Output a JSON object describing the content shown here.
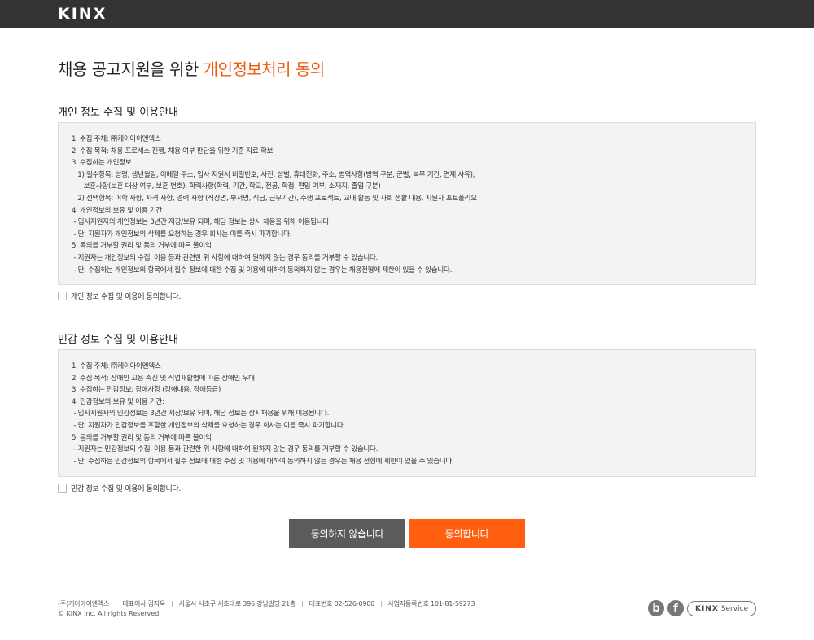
{
  "header": {
    "logo": "KINX"
  },
  "title": {
    "main": "채용 공고지원을 위한 ",
    "accent": "개인정보처리 동의"
  },
  "personal": {
    "heading": "개인 정보 수집 및 이용안내",
    "lines": [
      "1. 수집 주체: ㈜케이아이엔엑스",
      "2. 수집 목적: 채용 프로세스 진행, 채용 여부 판단을 위한 기준 자료 확보",
      "3. 수집하는 개인정보",
      "   1) 필수항목: 성명, 생년월일, 이메일 주소, 입사 지원서 비밀번호, 사진, 성별, 휴대전화, 주소, 병역사항(병역 구분, 군별, 복무 기간, 면제 사유),",
      "      보훈사항(보훈 대상 여부, 보훈 번호), 학력사항(학력, 기간, 학교, 전공, 학점, 편입 여부, 소재지, 졸업 구분)",
      "   2) 선택항목: 어학 사항, 자격 사항, 경력 사항 (직장명, 부서명, 직급, 근무기간), 수행 프로젝트, 교내 활동 및 사회 생활 내용, 지원자 포트폴리오",
      "4. 개인정보의 보유 및 이용 기간",
      " - 입사지원자의 개인정보는 3년간 저장/보유 되며, 해당 정보는 상시 채용을 위해 이용됩니다.",
      " - 단, 지원자가 개인정보의 삭제를 요청하는 경우 회사는 이를 즉시 파기합니다.",
      "5. 동의를 거부할 권리 및 동의 거부에 따른 불이익",
      " - 지원자는 개인정보의 수집, 이용 등과 관련한 위 사항에 대하여 원하지 않는 경우 동의를 거부할 수 있습니다.",
      " - 단, 수집하는 개인정보의 항목에서 필수 정보에 대한 수집 및 이용에 대하여 동의하지 않는 경우는 채용전형에 제한이 있을 수 있습니다."
    ],
    "agree_label": "개인 정보 수집 및 이용에 동의합니다."
  },
  "sensitive": {
    "heading": "민감 정보 수집 및 이용안내",
    "lines": [
      "1. 수집 주체: ㈜케이아이엔엑스",
      "2. 수집 목적: 장애인 고용 촉진 및 직업재활법에 따른 장애인 우대",
      "3. 수집하는 민감정보: 장애사항 (장애내용, 장애등급)",
      "4. 민감정보의 보유 및 이용 기간:",
      " - 입사지원자의 민감정보는 3년간 저장/보유 되며, 해당 정보는 상시채용을 위해 이용됩니다.",
      " - 단, 지원자가 민감정보를 포함한 개인정보의 삭제를 요청하는 경우 회사는 이를 즉시 파기합니다.",
      "5. 동의를 거부할 권리 및 동의 거부에 따른 불이익",
      " - 지원자는 민감정보의 수집, 이용 등과 관련한 위 사항에 대하여 원하지 않는 경우 동의를 거부할 수 있습니다.",
      " - 단, 수집하는 민감정보의 항목에서 필수 정보에 대한 수집 및 이용에 대하여 동의하지 않는 경우는 채용 전형에 제한이 있을 수 있습니다."
    ],
    "agree_label": "민감 정보 수집 및 이용에 동의합니다."
  },
  "buttons": {
    "decline": "동의하지 않습니다",
    "agree": "동의합니다"
  },
  "footer": {
    "company": "(주)케이아이엔엑스",
    "ceo": "대표이사 김지욱",
    "address": "서울시 서초구 서초대로 396 강남빌딩 21층",
    "phone": "대표번호 02-526-0900",
    "biz_no": "사업자등록번호 101-81-59273",
    "copyright": "© KINX Inc. All rights Reserved.",
    "social_b": "b",
    "social_f": "f",
    "service_brand": "KINX",
    "service_label": "Service"
  },
  "colors": {
    "accent": "#f05a0e",
    "button_agree": "#ff5f0f",
    "button_decline": "#5b5b5b",
    "topbar": "#333333"
  },
  "icons": {
    "checkbox": "checkbox-icon",
    "blog": "blog-b-icon",
    "facebook": "facebook-f-icon"
  }
}
